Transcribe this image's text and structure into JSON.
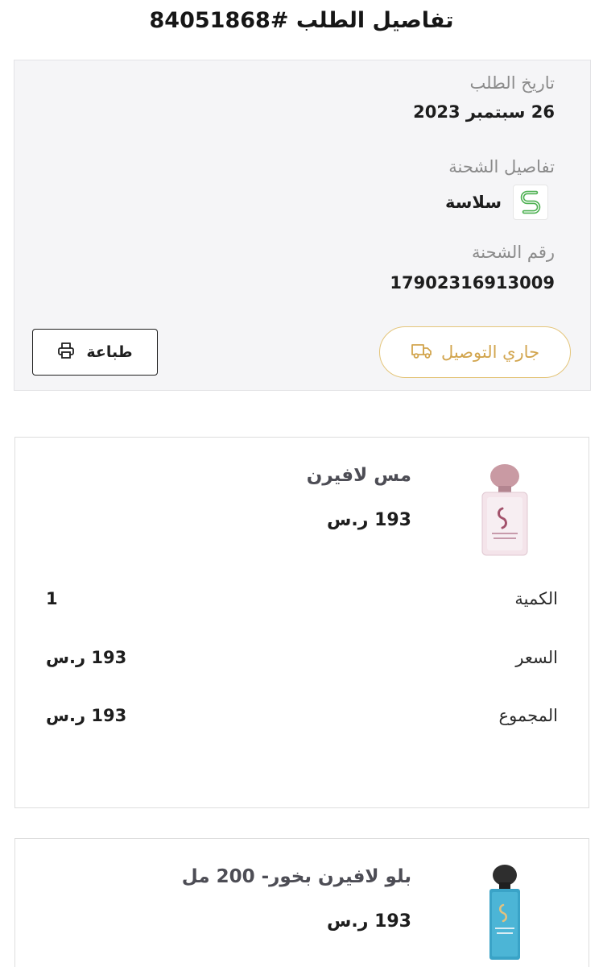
{
  "page": {
    "title": "تفاصيل الطلب #84051868"
  },
  "order": {
    "date_label": "تاريخ الطلب",
    "date_value": "26 سبتمبر 2023",
    "shipping_label": "تفاصيل الشحنة",
    "carrier_name": "سلاسة",
    "carrier_icon": "smsa-logo-icon",
    "tracking_label": "رقم الشحنة",
    "tracking_number": "17902316913009",
    "status_label": "جاري التوصيل",
    "status_icon": "truck-icon",
    "print_label": "طباعة",
    "print_icon": "printer-icon"
  },
  "colors": {
    "accent": "#d2a54e",
    "card_bg": "#f5f5f7"
  },
  "items": [
    {
      "name": "مس لافيرن",
      "price": "193 ر.س",
      "quantity_label": "الكمية",
      "quantity": "1",
      "price_label": "السعر",
      "unit_price": "193 ر.س",
      "total_label": "المجموع",
      "total": "193 ر.س"
    },
    {
      "name": "بلو لافيرن بخور- 200 مل",
      "price": "193 ر.س"
    }
  ]
}
